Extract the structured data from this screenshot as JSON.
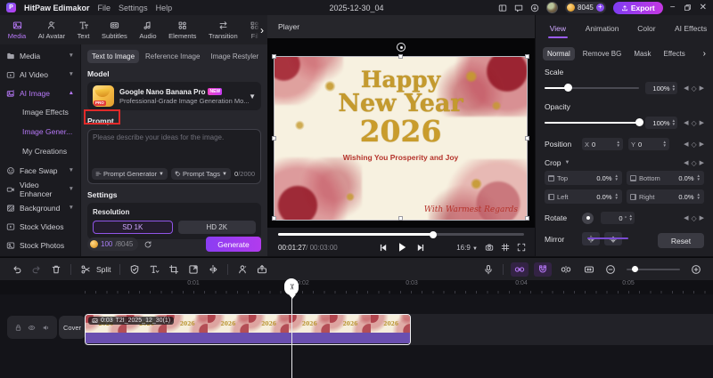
{
  "titlebar": {
    "app_name": "HitPaw Edimakor",
    "menus": [
      "File",
      "Settings",
      "Help"
    ],
    "project_name": "2025-12-30_04",
    "coins": "8045",
    "export_label": "Export"
  },
  "module_tabs": [
    "Media",
    "AI Avatar",
    "Text",
    "Subtitles",
    "Audio",
    "Elements",
    "Transition",
    "Fil"
  ],
  "sidebar": {
    "items": [
      {
        "label": "Media"
      },
      {
        "label": "AI Video"
      },
      {
        "label": "AI Image"
      },
      {
        "label": "Image Effects"
      },
      {
        "label": "Image Gener..."
      },
      {
        "label": "My Creations"
      },
      {
        "label": "Face Swap"
      },
      {
        "label": "Video Enhancer"
      },
      {
        "label": "Background"
      },
      {
        "label": "Stock Videos"
      },
      {
        "label": "Stock Photos"
      }
    ]
  },
  "ai_panel": {
    "tabs": [
      "Text to Image",
      "Reference Image",
      "Image Restyler"
    ],
    "model_label": "Model",
    "model": {
      "name": "Google Nano Banana Pro",
      "badge": "NEW",
      "pro": "PRO",
      "desc": "Professional-Grade Image Generation Mo..."
    },
    "prompt_label": "Prompt",
    "prompt_placeholder": "Please describe your ideas for the image.",
    "prompt_generator": "Prompt Generator",
    "prompt_tags": "Prompt Tags",
    "counter_current": "0",
    "counter_total": "/2000",
    "settings_label": "Settings",
    "resolution_label": "Resolution",
    "res_sd": "SD 1K",
    "res_hd": "HD 2K",
    "credits_current": "100",
    "credits_total": "/8045",
    "generate_label": "Generate"
  },
  "player": {
    "title": "Player",
    "time_current": "00:01:27",
    "time_total": " / 00:03:00",
    "aspect_ratio": "16:9",
    "preview": {
      "line1": "Happy",
      "line2": "New Year",
      "line3": "2026",
      "subtitle": "Wishing You Prosperity and Joy",
      "signoff": "With Warmest Regards"
    }
  },
  "properties": {
    "tabs": [
      "View",
      "Animation",
      "Color",
      "AI Effects"
    ],
    "subtabs": [
      "Normal",
      "Remove BG",
      "Mask",
      "Effects"
    ],
    "scale_label": "Scale",
    "scale_value": "100%",
    "opacity_label": "Opacity",
    "opacity_value": "100%",
    "position_label": "Position",
    "position_x_label": "X",
    "position_x_value": "0",
    "position_y_label": "Y",
    "position_y_value": "0",
    "crop_label": "Crop",
    "crop_fields": [
      {
        "label": "Top",
        "value": "0.0%"
      },
      {
        "label": "Bottom",
        "value": "0.0%"
      },
      {
        "label": "Left",
        "value": "0.0%"
      },
      {
        "label": "Right",
        "value": "0.0%"
      }
    ],
    "rotate_label": "Rotate",
    "rotate_value": "0",
    "rotate_unit": "°",
    "mirror_label": "Mirror",
    "reset_label": "Reset"
  },
  "timeline": {
    "split_label": "Split",
    "ruler": [
      "0:01",
      "0:02",
      "0:03",
      "0:04",
      "0:05"
    ],
    "cover_label": "Cover",
    "clip": {
      "duration": "0:03",
      "name": "T2I_2025_12_30(1)",
      "thumb_year": "2026"
    }
  },
  "colors": {
    "accent": "#9d55f2",
    "annotation_red": "#e12a2a",
    "clip_audio_bar": "#6a4fb0"
  }
}
